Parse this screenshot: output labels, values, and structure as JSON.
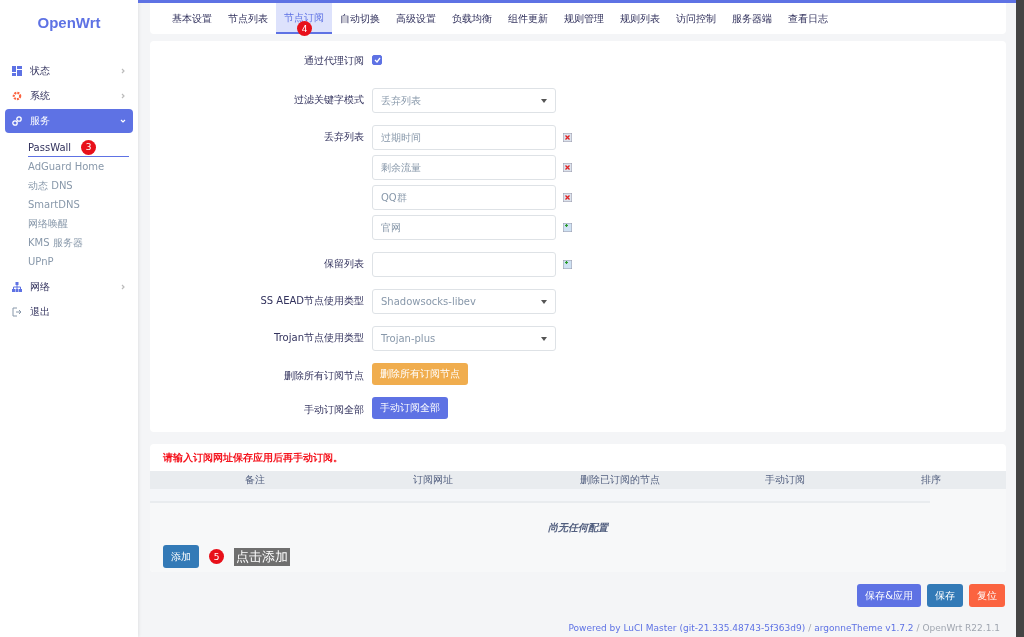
{
  "sidebar": {
    "logo": "OpenWrt",
    "items": [
      {
        "label": "状态",
        "expanded": false,
        "selected": false
      },
      {
        "label": "系统",
        "expanded": false,
        "selected": false
      },
      {
        "label": "服务",
        "expanded": true,
        "selected": true,
        "children": [
          {
            "label": "PassWall",
            "selected": true,
            "badge": "3"
          },
          {
            "label": "AdGuard Home",
            "selected": false
          },
          {
            "label": "动态 DNS",
            "selected": false
          },
          {
            "label": "SmartDNS",
            "selected": false
          },
          {
            "label": "网络唤醒",
            "selected": false
          },
          {
            "label": "KMS 服务器",
            "selected": false
          },
          {
            "label": "UPnP",
            "selected": false
          }
        ]
      },
      {
        "label": "网络",
        "expanded": false,
        "selected": false
      },
      {
        "label": "退出",
        "selected": false
      }
    ]
  },
  "tabs": [
    {
      "label": "基本设置",
      "selected": false
    },
    {
      "label": "节点列表",
      "selected": false
    },
    {
      "label": "节点订阅",
      "selected": true,
      "badge": "4"
    },
    {
      "label": "自动切换",
      "selected": false
    },
    {
      "label": "高级设置",
      "selected": false
    },
    {
      "label": "负载均衡",
      "selected": false
    },
    {
      "label": "组件更新",
      "selected": false
    },
    {
      "label": "规则管理",
      "selected": false
    },
    {
      "label": "规则列表",
      "selected": false
    },
    {
      "label": "访问控制",
      "selected": false
    },
    {
      "label": "服务器端",
      "selected": false
    },
    {
      "label": "查看日志",
      "selected": false
    }
  ],
  "form": [
    {
      "kind": "checkbox",
      "label": "通过代理订阅",
      "checked": true
    },
    {
      "kind": "select",
      "label": "过滤关键字模式",
      "value": "丢弃列表"
    },
    {
      "kind": "list",
      "label": "丢弃列表",
      "entries": [
        {
          "value": "过期时间",
          "kind": "remove"
        },
        {
          "value": "剩余流量",
          "kind": "remove"
        },
        {
          "value": "QQ群",
          "kind": "remove"
        },
        {
          "value": "官网",
          "kind": "add"
        }
      ]
    },
    {
      "kind": "list",
      "label": "保留列表",
      "entries": [
        {
          "kind": "add"
        }
      ]
    },
    {
      "kind": "select",
      "label": "SS AEAD节点使用类型",
      "value": "Shadowsocks-libev"
    },
    {
      "kind": "select",
      "label": "Trojan节点使用类型",
      "value": "Trojan-plus"
    },
    {
      "kind": "button",
      "label": "删除所有订阅节点",
      "button": "删除所有订阅节点",
      "color": "#f0ad4e"
    },
    {
      "kind": "button",
      "label": "手动订阅全部",
      "button": "手动订阅全部",
      "color": "#5e72e4"
    }
  ],
  "subscriptions": {
    "note": "请输入订阅网址保存应用后再手动订阅。",
    "columns": [
      "备注",
      "订阅网址",
      "删除已订阅的节点",
      "手动订阅",
      "排序"
    ],
    "empty": "尚无任何配置",
    "add_button": "添加",
    "badge": "5",
    "callout": "点击添加"
  },
  "actions": [
    {
      "label": "保存&应用",
      "color": "#5e72e4"
    },
    {
      "label": "保存",
      "color": "#337ab7"
    },
    {
      "label": "复位",
      "color": "#fb6340"
    }
  ],
  "footer": [
    {
      "text": "Powered by LuCI Master (git-21.335.48743-5f363d9)",
      "link": true
    },
    {
      "text": "/",
      "link": false
    },
    {
      "text": "argonneTheme v1.7.2",
      "link": true
    },
    {
      "text": "/ OpenWrt R22.1.1",
      "link": false
    }
  ]
}
